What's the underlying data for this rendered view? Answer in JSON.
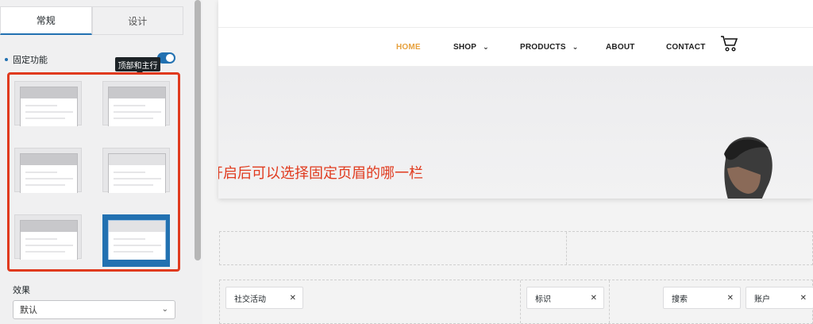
{
  "panel": {
    "tabs": [
      {
        "label": "常规",
        "active": true
      },
      {
        "label": "设计",
        "active": false
      }
    ],
    "sticky_label": "固定功能",
    "sticky_enabled": true,
    "tooltip": "顶部和主行",
    "effect_label": "效果",
    "effect_value": "默认",
    "selected_option_index": 5
  },
  "preview": {
    "nav": [
      {
        "label": "HOME",
        "has_dropdown": false,
        "active": true
      },
      {
        "label": "SHOP",
        "has_dropdown": true,
        "active": false
      },
      {
        "label": "PRODUCTS",
        "has_dropdown": true,
        "active": false
      },
      {
        "label": "ABOUT",
        "has_dropdown": false,
        "active": false
      },
      {
        "label": "CONTACT",
        "has_dropdown": false,
        "active": false
      }
    ],
    "annotation": "开启后可以选择固定页眉的哪一栏",
    "chips": [
      "社交活动",
      "标识",
      "搜索",
      "账户"
    ]
  },
  "colors": {
    "accent": "#2271b1",
    "annotation": "#e03a1e",
    "nav_active": "#e7a13d"
  }
}
